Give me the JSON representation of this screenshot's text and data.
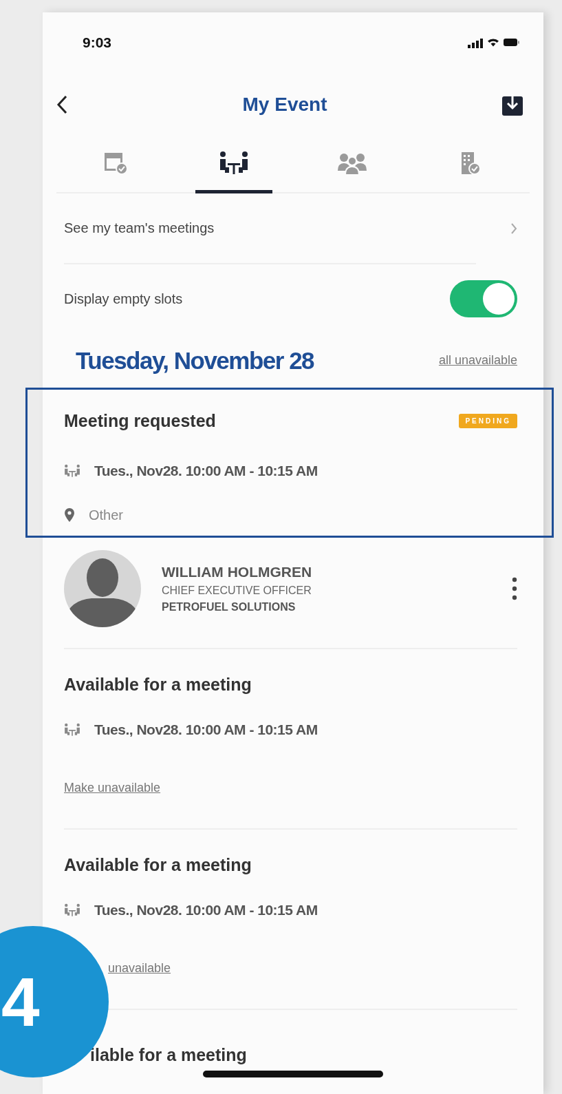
{
  "status_bar": {
    "time": "9:03"
  },
  "nav": {
    "title": "My Event"
  },
  "tabs": [
    {
      "kind": "calendar",
      "selected": false
    },
    {
      "kind": "meeting",
      "selected": true
    },
    {
      "kind": "people",
      "selected": false
    },
    {
      "kind": "building",
      "selected": false
    }
  ],
  "team_link": {
    "label": "See my team's meetings"
  },
  "empty_slots": {
    "label": "Display empty slots",
    "on": true
  },
  "date_heading": {
    "title": "Tuesday, November 28",
    "link": "all unavailable"
  },
  "slots": [
    {
      "kind": "request",
      "highlighted": true,
      "title": "Meeting requested",
      "badge": "PENDING",
      "time": "Tues., Nov28. 10:00 AM - 10:15 AM",
      "location": "Other",
      "person": {
        "name": "WILLIAM HOLMGREN",
        "role": "CHIEF EXECUTIVE OFFICER",
        "company": "PETROFUEL SOLUTIONS"
      }
    },
    {
      "kind": "available",
      "title": "Available for a meeting",
      "time": "Tues., Nov28. 10:00 AM - 10:15 AM",
      "link": "Make unavailable"
    },
    {
      "kind": "available",
      "title": "Available for a meeting",
      "time": "Tues., Nov28. 10:00 AM - 10:15 AM",
      "link": "unavailable"
    },
    {
      "kind": "partial",
      "title": "ilable for a meeting"
    }
  ],
  "callout": {
    "number": "4"
  }
}
